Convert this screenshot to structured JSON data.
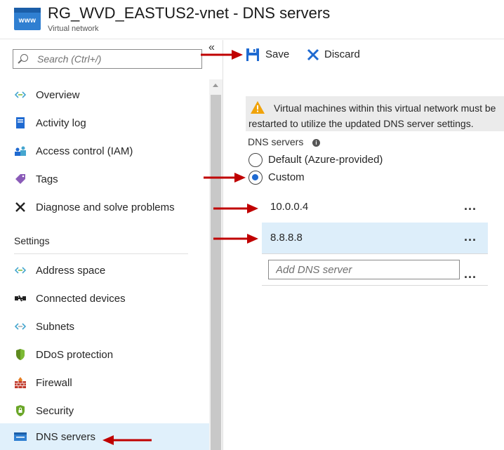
{
  "header": {
    "icon_text": "www",
    "title": "RG_WVD_EASTUS2-vnet - DNS servers",
    "subtitle": "Virtual network"
  },
  "sidebar": {
    "search_placeholder": "Search (Ctrl+/)",
    "collapse_glyph": "«",
    "items": [
      {
        "label": "Overview",
        "icon": "vnet-icon"
      },
      {
        "label": "Activity log",
        "icon": "activity-log-icon"
      },
      {
        "label": "Access control (IAM)",
        "icon": "iam-icon"
      },
      {
        "label": "Tags",
        "icon": "tag-icon"
      },
      {
        "label": "Diagnose and solve problems",
        "icon": "wrench-icon"
      }
    ],
    "settings_label": "Settings",
    "settings_items": [
      {
        "label": "Address space",
        "icon": "vnet-icon"
      },
      {
        "label": "Connected devices",
        "icon": "devices-icon"
      },
      {
        "label": "Subnets",
        "icon": "vnet-icon"
      },
      {
        "label": "DDoS protection",
        "icon": "shield-icon"
      },
      {
        "label": "Firewall",
        "icon": "firewall-icon"
      },
      {
        "label": "Security",
        "icon": "security-icon"
      },
      {
        "label": "DNS servers",
        "icon": "dns-icon",
        "selected": true
      }
    ]
  },
  "toolbar": {
    "save_label": "Save",
    "discard_label": "Discard"
  },
  "warning": {
    "text": "Virtual machines within this virtual network must be restarted to utilize the updated DNS server settings."
  },
  "dns": {
    "label": "DNS servers",
    "options": [
      {
        "label": "Default (Azure-provided)",
        "selected": false
      },
      {
        "label": "Custom",
        "selected": true
      }
    ],
    "servers": [
      "10.0.0.4",
      "8.8.8.8"
    ],
    "more_glyph": "...",
    "add_placeholder": "Add DNS server"
  },
  "colors": {
    "accent": "#1f6ad1",
    "selected_bg": "#e0f0fb",
    "arrow": "#c00000",
    "warning_icon": "#f0a30a"
  }
}
